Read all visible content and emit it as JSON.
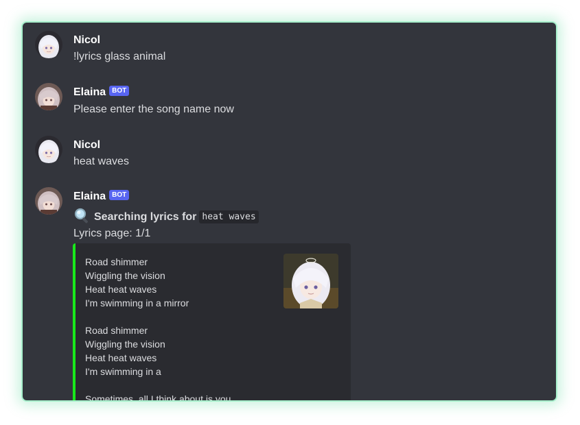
{
  "messages": [
    {
      "author": "Nicol",
      "text": "!lyrics glass animal"
    },
    {
      "author": "Elaina",
      "badge": "BOT",
      "text": "Please enter the song name now"
    },
    {
      "author": "Nicol",
      "text": "heat waves"
    },
    {
      "author": "Elaina",
      "badge": "BOT",
      "search_icon": "magnifier-icon",
      "search_label": "Searching lyrics for",
      "search_query": "heat waves",
      "page_text": "Lyrics page: 1/1"
    }
  ],
  "embed": {
    "accent_color": "#19e81b",
    "lyrics": [
      "Road shimmer",
      "Wiggling the vision",
      "Heat heat waves",
      "I'm swimming in a mirror",
      "",
      "Road shimmer",
      "Wiggling the vision",
      "Heat heat waves",
      "I'm swimming in a",
      "",
      "Sometimes, all I think about is you"
    ]
  },
  "colors": {
    "background": "#33353c",
    "border": "#a7f0cc",
    "badge": "#5865f2"
  }
}
